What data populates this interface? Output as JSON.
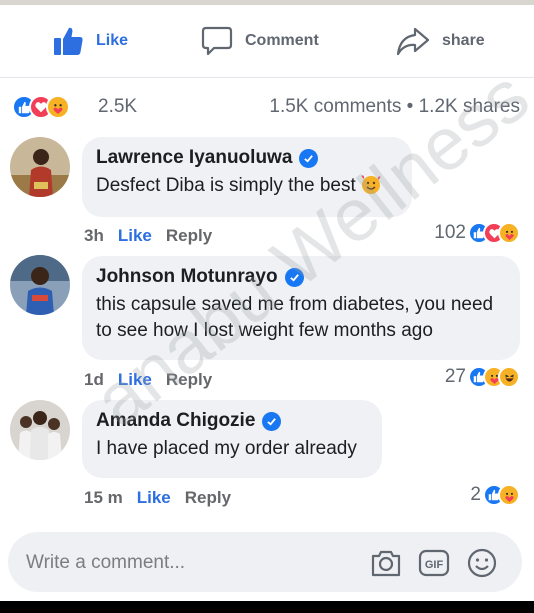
{
  "actions": {
    "like_label": "Like",
    "comment_label": "Comment",
    "share_label": "share"
  },
  "summary": {
    "reaction_count": "2.5K",
    "stats": "1.5K comments • 1.2K shares",
    "reactions": [
      "like",
      "love",
      "care"
    ]
  },
  "comments": [
    {
      "author": "Lawrence Iyanuoluwa",
      "text": "Desfect Diba is simply the best",
      "time": "3h",
      "like_label": "Like",
      "reply_label": "Reply",
      "reaction_count": "102",
      "reactions": [
        "like",
        "love",
        "care"
      ]
    },
    {
      "author": "Johnson Motunrayo",
      "text": "this capsule saved me from diabetes, you need to see how I lost weight few months ago",
      "time": "1d",
      "like_label": "Like",
      "reply_label": "Reply",
      "reaction_count": "27",
      "reactions": [
        "like",
        "care",
        "haha"
      ]
    },
    {
      "author": "Amanda Chigozie",
      "text": "I have placed my order already",
      "time": "15 m",
      "like_label": "Like",
      "reply_label": "Reply",
      "reaction_count": "2",
      "reactions": [
        "like",
        "care"
      ]
    }
  ],
  "composer": {
    "placeholder": "Write a comment...",
    "gif_label": "GIF"
  },
  "watermark": "anabu Wellness",
  "colors": {
    "accent": "#1877f2",
    "link_blue": "#2d6fe0",
    "love": "#f33e58",
    "care": "#f7b125",
    "bubble": "#eff1f4"
  }
}
